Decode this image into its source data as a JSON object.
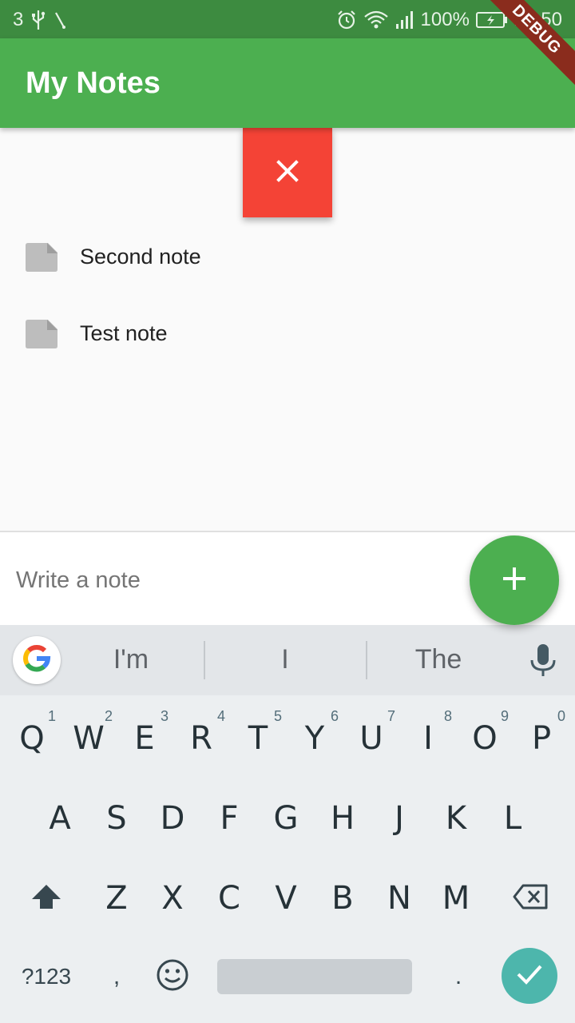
{
  "status_bar": {
    "sim_label": "3",
    "battery_percent": "100%",
    "time": "21:50"
  },
  "debug_banner": "DEBUG",
  "app_bar": {
    "title": "My Notes"
  },
  "notes": [
    {
      "label": "Second note",
      "icon": "note-icon"
    },
    {
      "label": "Test note",
      "icon": "note-icon"
    }
  ],
  "input": {
    "placeholder": "Write a note",
    "value": ""
  },
  "keyboard": {
    "suggestions": [
      "I'm",
      "I",
      "The"
    ],
    "row1": [
      {
        "k": "Q",
        "s": "1"
      },
      {
        "k": "W",
        "s": "2"
      },
      {
        "k": "E",
        "s": "3"
      },
      {
        "k": "R",
        "s": "4"
      },
      {
        "k": "T",
        "s": "5"
      },
      {
        "k": "Y",
        "s": "6"
      },
      {
        "k": "U",
        "s": "7"
      },
      {
        "k": "I",
        "s": "8"
      },
      {
        "k": "O",
        "s": "9"
      },
      {
        "k": "P",
        "s": "0"
      }
    ],
    "row2": [
      "A",
      "S",
      "D",
      "F",
      "G",
      "H",
      "J",
      "K",
      "L"
    ],
    "row3": [
      "Z",
      "X",
      "C",
      "V",
      "B",
      "N",
      "M"
    ],
    "symbols_key": "?123",
    "comma_key": ",",
    "period_key": "."
  },
  "colors": {
    "app_bar": "#4caf50",
    "status_bar": "#3d8b40",
    "dismiss": "#f44336",
    "fab": "#4caf50",
    "enter": "#4db6ac"
  }
}
